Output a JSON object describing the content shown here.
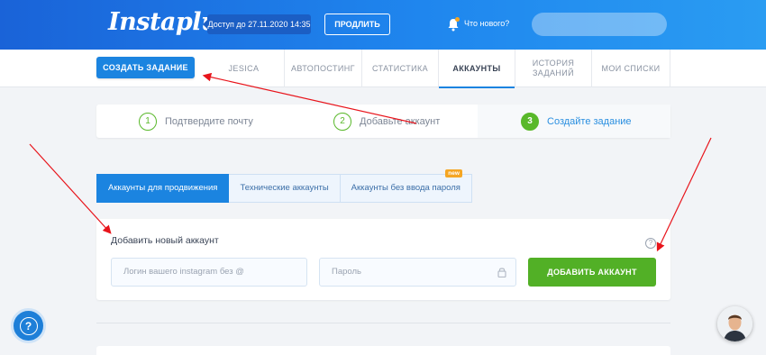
{
  "header": {
    "logo": "Instaplus",
    "access": "Доступ до 27.11.2020 14:35",
    "extend_label": "ПРОДЛИТЬ",
    "whatsnew": "Что нового?"
  },
  "nav": {
    "create_label": "СОЗДАТЬ ЗАДАНИЕ",
    "tabs": [
      {
        "label": "JESICA"
      },
      {
        "label": "АВТОПОСТИНГ"
      },
      {
        "label": "СТАТИСТИКА"
      },
      {
        "label": "АККАУНТЫ",
        "active": true
      },
      {
        "label_line1": "ИСТОРИЯ",
        "label_line2": "ЗАДАНИЙ"
      },
      {
        "label": "МОИ СПИСКИ"
      }
    ]
  },
  "steps": [
    {
      "num": "1",
      "label": "Подтвердите почту"
    },
    {
      "num": "2",
      "label": "Добавьте аккаунт"
    },
    {
      "num": "3",
      "label": "Создайте задание"
    }
  ],
  "subtabs": [
    {
      "label": "Аккаунты для продвижения"
    },
    {
      "label": "Технические аккаунты"
    },
    {
      "label": "Аккаунты без ввода пароля",
      "badge": "new"
    }
  ],
  "add_account": {
    "title": "Добавить новый аккаунт",
    "help": "?",
    "login_placeholder": "Логин вашего instagram без @",
    "password_placeholder": "Пароль",
    "submit_label": "ДОБАВИТЬ АККАУНТ"
  },
  "help_fab": "?",
  "colors": {
    "primary": "#1b84e0",
    "success": "#52b026",
    "annotation_arrow": "#e8141b"
  }
}
